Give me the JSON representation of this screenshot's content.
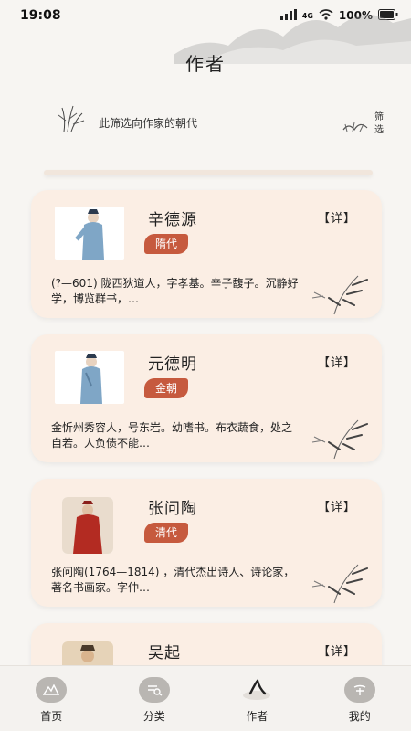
{
  "status_bar": {
    "time": "19:08",
    "network": "4G",
    "battery": "100%"
  },
  "page": {
    "title": "作者"
  },
  "filter": {
    "hint": "此筛选向作家的朝代",
    "button_label_top": "筛",
    "button_label_bottom": "选"
  },
  "authors": [
    {
      "name": "辛德源",
      "dynasty": "隋代",
      "detail_label": "【详】",
      "description": "(?—601) 陇西狄道人，字孝基。辛子馥子。沉静好学，博览群书，…"
    },
    {
      "name": "元德明",
      "dynasty": "金朝",
      "detail_label": "【详】",
      "description": "金忻州秀容人，号东岩。幼嗜书。布衣蔬食，处之自若。人负债不能…"
    },
    {
      "name": "张问陶",
      "dynasty": "清代",
      "detail_label": "【详】",
      "description": "张问陶(1764—1814) ，清代杰出诗人、诗论家，著名书画家。字仲…"
    },
    {
      "name": "吴起",
      "dynasty": "",
      "detail_label": "【详】",
      "description": ""
    }
  ],
  "tabs": [
    {
      "label": "首页",
      "icon": "mountain-icon"
    },
    {
      "label": "分类",
      "icon": "category-icon"
    },
    {
      "label": "作者",
      "icon": "author-icon"
    },
    {
      "label": "我的",
      "icon": "profile-icon"
    }
  ],
  "colors": {
    "accent": "#c65a3e",
    "card_bg": "#fbeee4",
    "page_bg": "#f7f5f2"
  }
}
